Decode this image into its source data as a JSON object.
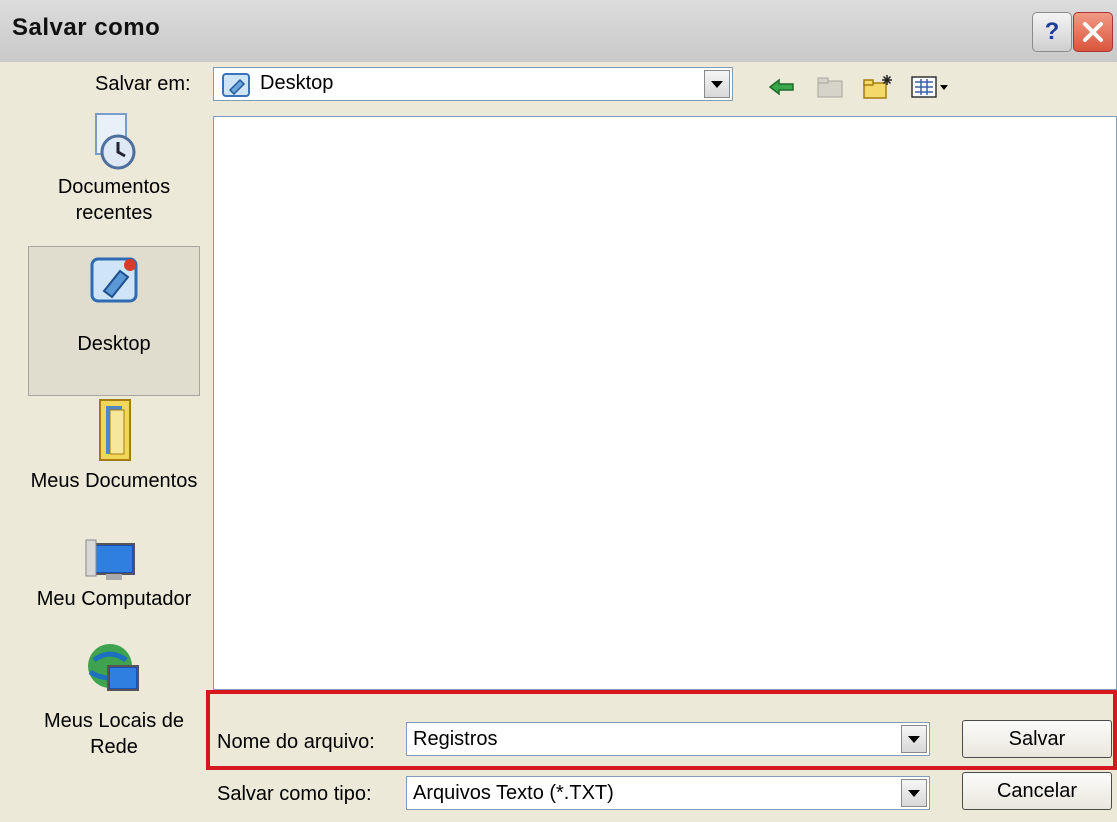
{
  "window": {
    "title": "Salvar como",
    "help_label": "?",
    "colors": {
      "titlebar": "#d6d6d6",
      "close": "#d9553c",
      "highlight": "#d8161e"
    }
  },
  "toolbar": {
    "save_in_label": "Salvar em:",
    "current_folder": "Desktop",
    "icons": [
      "back-arrow-icon",
      "up-folder-icon",
      "new-folder-icon",
      "view-menu-icon"
    ]
  },
  "places": [
    {
      "label": "Documentos recentes",
      "icon": "recent-documents-icon"
    },
    {
      "label": "Desktop",
      "icon": "desktop-icon",
      "selected": true
    },
    {
      "label": "Meus Documentos",
      "icon": "my-documents-icon"
    },
    {
      "label": "Meu Computador",
      "icon": "my-computer-icon"
    },
    {
      "label": "Meus Locais de Rede",
      "icon": "network-places-icon"
    }
  ],
  "file_name": {
    "label": "Nome do arquivo:",
    "value": "Registros"
  },
  "file_type": {
    "label": "Salvar como tipo:",
    "value": "Arquivos Texto (*.TXT)"
  },
  "buttons": {
    "save": "Salvar",
    "cancel": "Cancelar"
  }
}
